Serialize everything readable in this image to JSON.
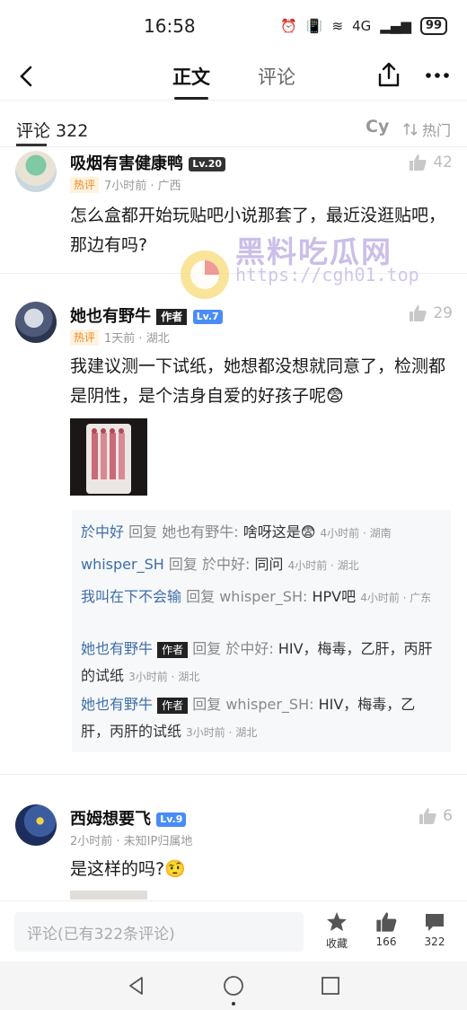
{
  "status_bar": {
    "time": "16:58",
    "network": "4G",
    "battery": "99"
  },
  "nav": {
    "tab_article": "正文",
    "tab_comments": "评论"
  },
  "comments_header": {
    "title": "评论 322",
    "cy": "Cy",
    "sort": "热门"
  },
  "watermark": {
    "text": "黑料吃瓜网",
    "url": "https://cgh01.top"
  },
  "comments": [
    {
      "user": "吸烟有害健康鸭",
      "level": "Lv.20",
      "hot_tag": "热评",
      "meta": "7小时前 · 广西",
      "text": "怎么盒都开始玩贴吧小说那套了，最近没逛贴吧，那边有吗?",
      "likes": "42"
    },
    {
      "user": "她也有野牛",
      "author_badge": "作者",
      "level": "Lv.7",
      "hot_tag": "热评",
      "meta": "1天前 · 湖北",
      "text": "我建议测一下试纸，她想都没想就同意了，检测都是阴性，是个洁身自爱的好孩子呢😨",
      "likes": "29",
      "replies": [
        {
          "from": "於中好",
          "label": "回复",
          "to": "她也有野牛:",
          "text": "啥呀这是😨",
          "time": "4小时前 · 湖南"
        },
        {
          "from": "whisper_SH",
          "label": "回复",
          "to": "於中好:",
          "text": "同问",
          "time": "4小时前 · 湖北"
        },
        {
          "from": "我叫在下不会输",
          "label": "回复",
          "to": "whisper_SH:",
          "text": "HPV吧",
          "time": "4小时前 · 广东"
        },
        {
          "from": "她也有野牛",
          "author_badge": "作者",
          "label": "回复",
          "to": "於中好:",
          "text": "HIV，梅毒，乙肝，丙肝的试纸",
          "time": "3小时前 · 湖北"
        },
        {
          "from": "她也有野牛",
          "author_badge": "作者",
          "label": "回复",
          "to": "whisper_SH:",
          "text": "HIV，梅毒，乙肝，丙肝的试纸",
          "time": "3小时前 · 湖北"
        }
      ]
    },
    {
      "user": "西姆想要飞",
      "level": "Lv.9",
      "meta": "2小时前 · 未知IP归属地",
      "text": "是这样的吗?🤨",
      "likes": "6"
    }
  ],
  "bottom_bar": {
    "input_placeholder": "评论(已有322条评论)",
    "collect_label": "收藏",
    "like_count": "166",
    "comment_count": "322"
  },
  "colors": {
    "accent_link": "#3d6ea8",
    "hot_tag": "#f08a24",
    "level_badge": "#4a8cf7"
  }
}
